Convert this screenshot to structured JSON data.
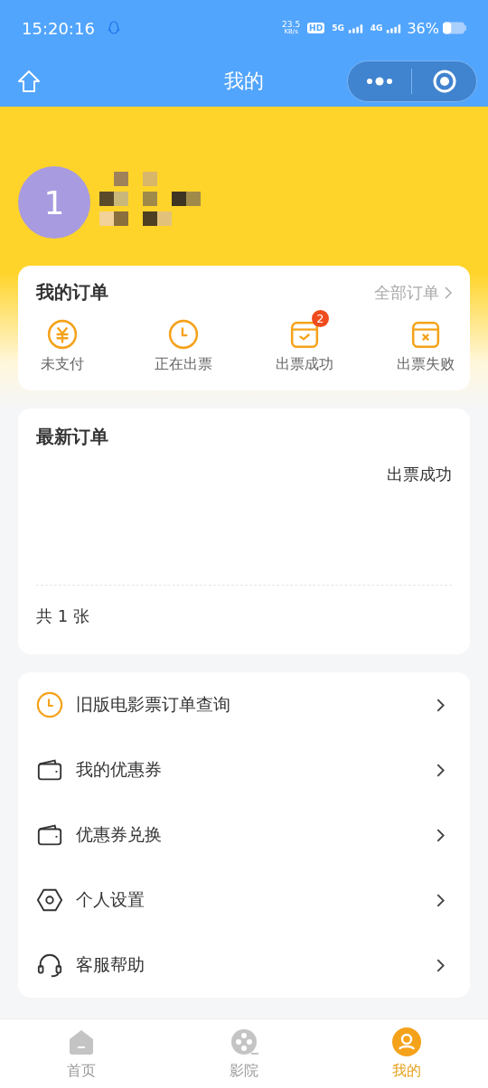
{
  "status_bar": {
    "time": "15:20:16",
    "speed": "23.5",
    "speed_unit": "KB/s",
    "hd": "HD",
    "net1": "5G",
    "net2": "4G",
    "battery": "36%"
  },
  "nav": {
    "title": "我的"
  },
  "profile": {
    "avatar": "1"
  },
  "orders": {
    "title": "我的订单",
    "all_link": "全部订单",
    "items": [
      {
        "kind": "yuan",
        "label": "未支付"
      },
      {
        "kind": "clock",
        "label": "正在出票"
      },
      {
        "kind": "check",
        "label": "出票成功",
        "badge": "2"
      },
      {
        "kind": "cross",
        "label": "出票失败"
      }
    ]
  },
  "latest": {
    "title": "最新订单",
    "status": "出票成功",
    "count": "共 1 张"
  },
  "menu": [
    {
      "kind": "clock",
      "label": "旧版电影票订单查询"
    },
    {
      "kind": "wallet",
      "label": "我的优惠券"
    },
    {
      "kind": "wallet",
      "label": "优惠券兑换"
    },
    {
      "kind": "hexagon",
      "label": "个人设置"
    },
    {
      "kind": "headset",
      "label": "客服帮助"
    }
  ],
  "tabs": [
    {
      "kind": "home",
      "label": "首页",
      "selected": false
    },
    {
      "kind": "film",
      "label": "影院",
      "selected": false
    },
    {
      "kind": "user",
      "label": "我的",
      "selected": true
    }
  ]
}
